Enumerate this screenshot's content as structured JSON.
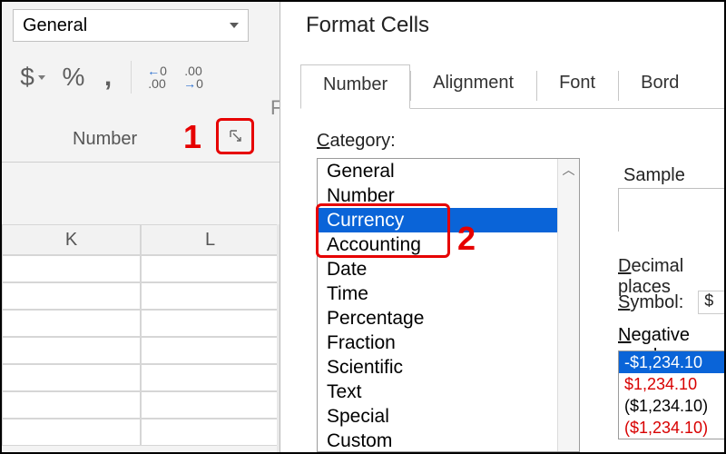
{
  "ribbon": {
    "format_value": "General",
    "group_label": "Number",
    "buttons": {
      "accounting": "$",
      "percent": "%",
      "comma": ","
    },
    "decimal": {
      "inc_top": "←0",
      "inc_bot": ".00",
      "dec_top": ".00",
      "dec_bot": "→0"
    }
  },
  "sheet": {
    "col1": "K",
    "col2": "L"
  },
  "dialog": {
    "title": "Format Cells",
    "tabs": [
      "Number",
      "Alignment",
      "Font",
      "Bord"
    ],
    "category_label_pre": "C",
    "category_label_rest": "ategory:",
    "categories": [
      "General",
      "Number",
      "Currency",
      "Accounting",
      "Date",
      "Time",
      "Percentage",
      "Fraction",
      "Scientific",
      "Text",
      "Special",
      "Custom"
    ],
    "selected_category_index": 2,
    "sample_label": "Sample",
    "decimal_pre": "D",
    "decimal_rest": "ecimal places",
    "symbol_pre": "S",
    "symbol_rest": "ymbol:",
    "symbol_value": "$",
    "neg_pre": "N",
    "neg_rest": "egative numb",
    "negatives": [
      "-$1,234.10",
      "$1,234.10",
      "($1,234.10)",
      "($1,234.10)"
    ]
  },
  "annotations": {
    "one": "1",
    "two": "2"
  },
  "misc": {
    "partial_f": "F"
  }
}
